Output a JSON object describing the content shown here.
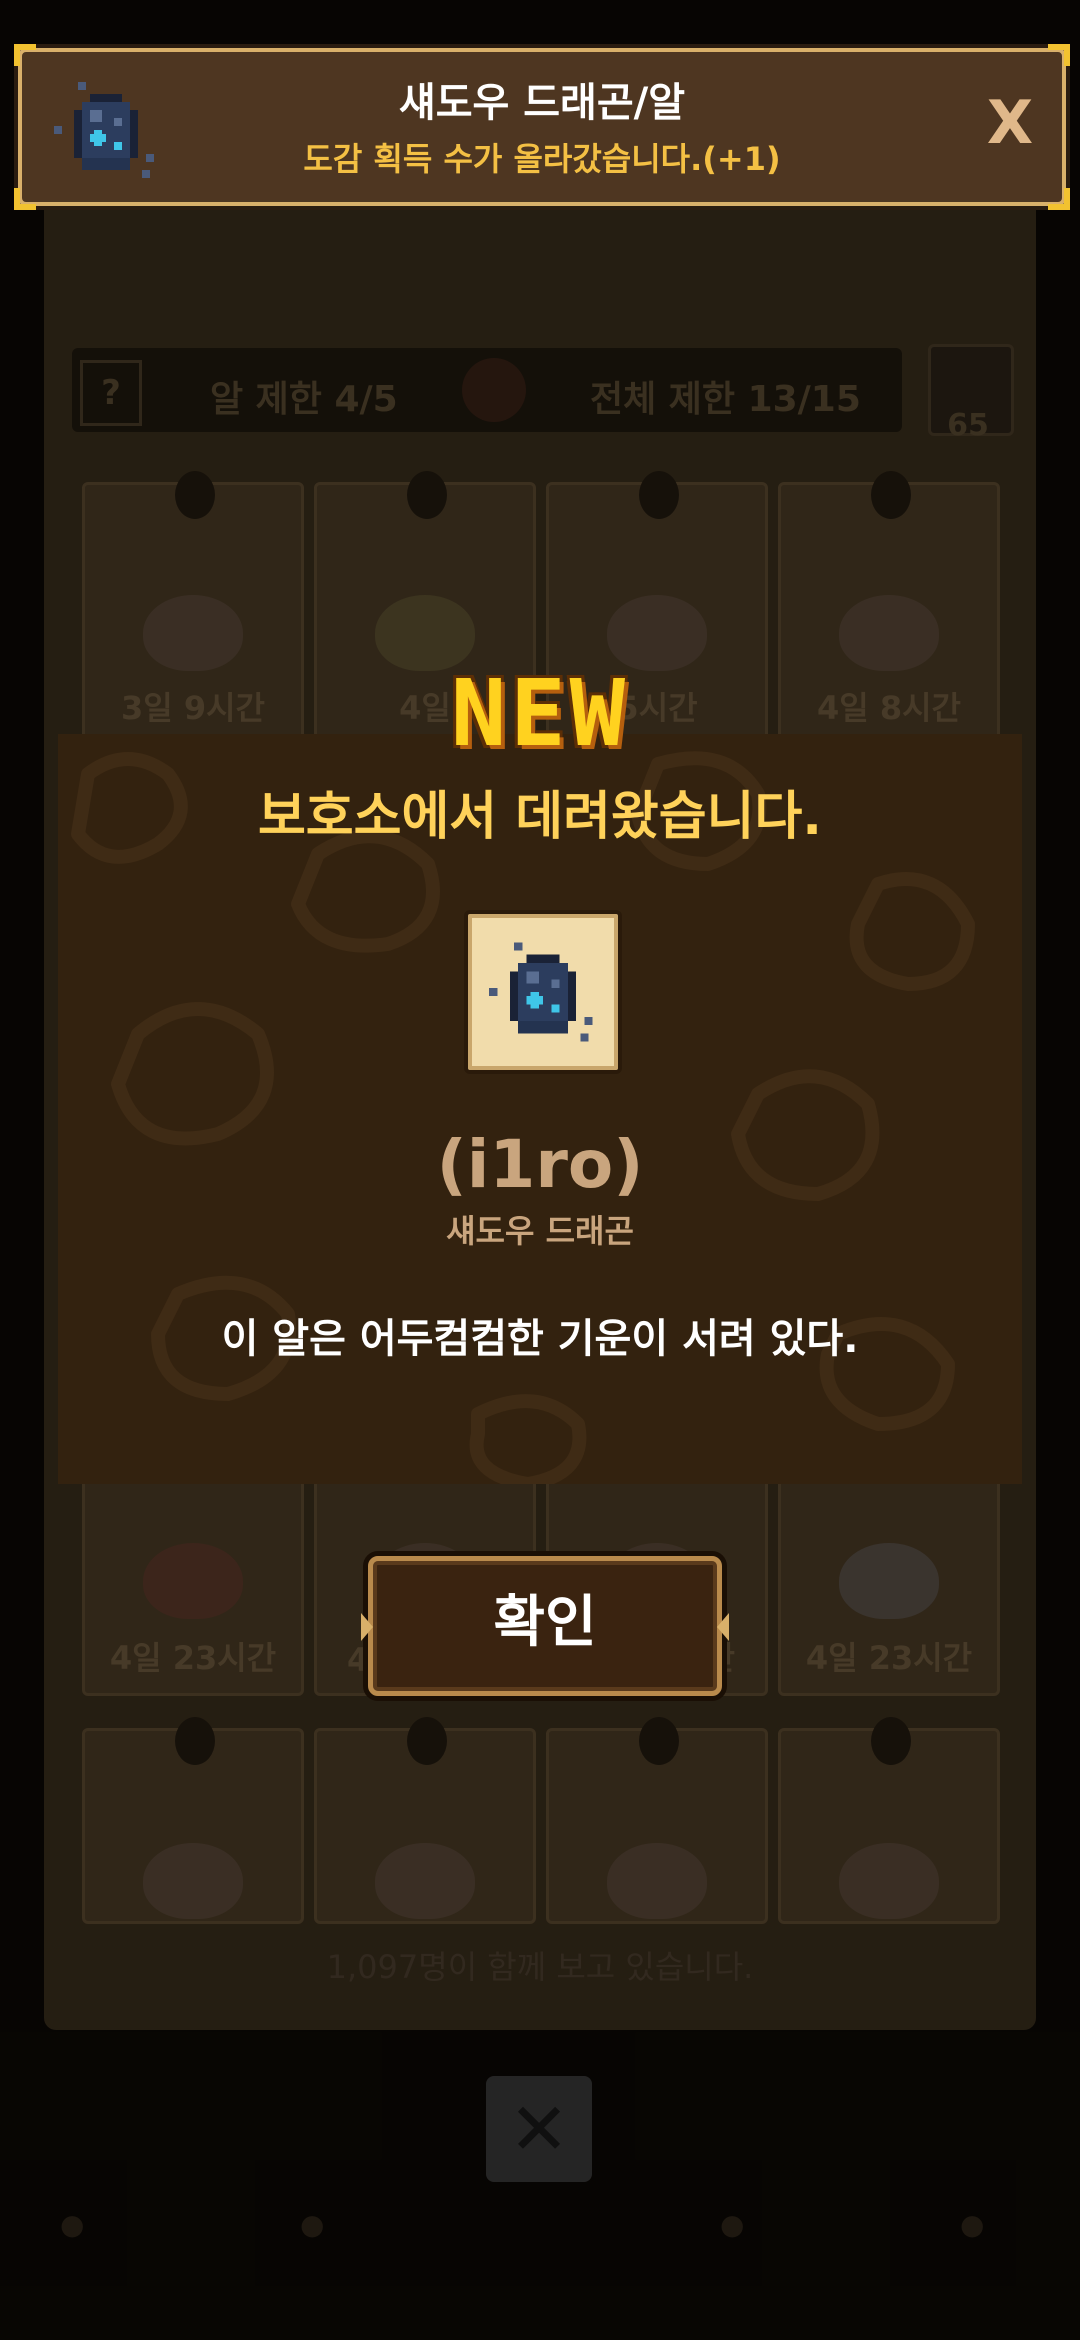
{
  "background": {
    "description_lines": [
      "",
      "",
      ""
    ],
    "limits": {
      "egg_limit_label": "알 제한",
      "egg_limit_value": "4/5",
      "total_limit_label": "전체 제한",
      "total_limit_value": "13/15",
      "refresh_count": "65"
    },
    "cards_row1": [
      {
        "timer": "3일 9시간"
      },
      {
        "timer": "4일"
      },
      {
        "timer": "5시간"
      },
      {
        "timer": "4일 8시간"
      }
    ],
    "cards_row2": [
      {
        "timer": "4일 23시간"
      },
      {
        "timer": "4"
      },
      {
        "timer": "간"
      },
      {
        "timer": "4일 23시간"
      }
    ],
    "footer_text": "1,097명이 함께 보고 있습니다."
  },
  "banner": {
    "title": "섀도우 드래곤/알",
    "subtitle": "도감 획득 수가 올라갔습니다.(+1)",
    "close_label": "X",
    "icon": "shadow-dragon-egg-icon"
  },
  "popup": {
    "new_label": "NEW",
    "title": "보호소에서 데려왔습니다.",
    "item_name": "(i1ro)",
    "item_type": "섀도우 드래곤",
    "description": "이 알은 어두컴컴한 기운이 서려 있다.",
    "confirm_label": "확인",
    "item_icon": "shadow-dragon-egg-icon"
  },
  "colors": {
    "accent_gold": "#ffd25a",
    "banner_bg": "#4e3621",
    "popup_bg": "#33220f",
    "egg_dark": "#2c3d5e",
    "egg_glow": "#3fc6e8"
  }
}
